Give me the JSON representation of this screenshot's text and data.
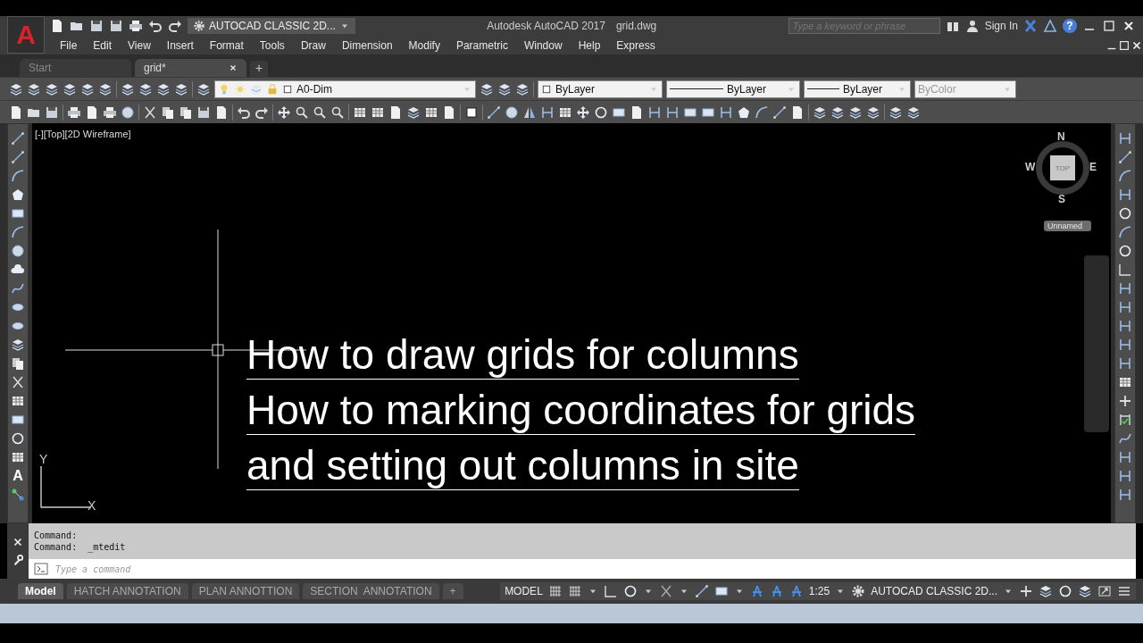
{
  "title_bar": {
    "app_logo": "A",
    "workspace": "AUTOCAD CLASSIC 2D...",
    "title": "Autodesk AutoCAD 2017",
    "file": "grid.dwg",
    "search": {
      "placeholder": "Type a keyword or phrase"
    },
    "sign_in": "Sign In",
    "help": "?"
  },
  "menu": [
    "File",
    "Edit",
    "View",
    "Insert",
    "Format",
    "Tools",
    "Draw",
    "Dimension",
    "Modify",
    "Parametric",
    "Window",
    "Help",
    "Express"
  ],
  "file_tabs": [
    {
      "label": "Start",
      "selected": false
    },
    {
      "label": "grid*",
      "selected": true
    }
  ],
  "new_tab": "+",
  "properties_toolbar": {
    "layer": "A0-Dim",
    "color_control": "ByLayer",
    "linetype": "ByLayer",
    "lineweight": "ByLayer",
    "plot_style": {
      "value": "ByColor",
      "disabled": true
    }
  },
  "viewport": {
    "label": "[-][Top][2D Wireframe]",
    "text_lines": [
      "How to draw grids for columns",
      "How to marking coordinates for grids",
      "and setting out columns in site"
    ],
    "ucs": {
      "x": "X",
      "y": "Y"
    },
    "viewcube": {
      "north": "N",
      "south": "S",
      "east": "E",
      "west": "W",
      "face": "TOP"
    },
    "view_name": "Unnamed",
    "text_tool": "A"
  },
  "command_line": {
    "history": [
      "Command:",
      "Command:  _mtedit"
    ],
    "placeholder": "Type a command"
  },
  "layout_tabs": [
    {
      "label": "Model",
      "selected": true
    },
    {
      "label": "HATCH ANNOTATION",
      "selected": false
    },
    {
      "label": "PLAN ANNOTTION",
      "selected": false
    },
    {
      "label": "SECTION  ANNOTATION",
      "selected": false
    }
  ],
  "add_layout": "+",
  "status_bar": {
    "space": "MODEL",
    "scale": "1:25",
    "workspace": "AUTOCAD CLASSIC 2D..."
  }
}
